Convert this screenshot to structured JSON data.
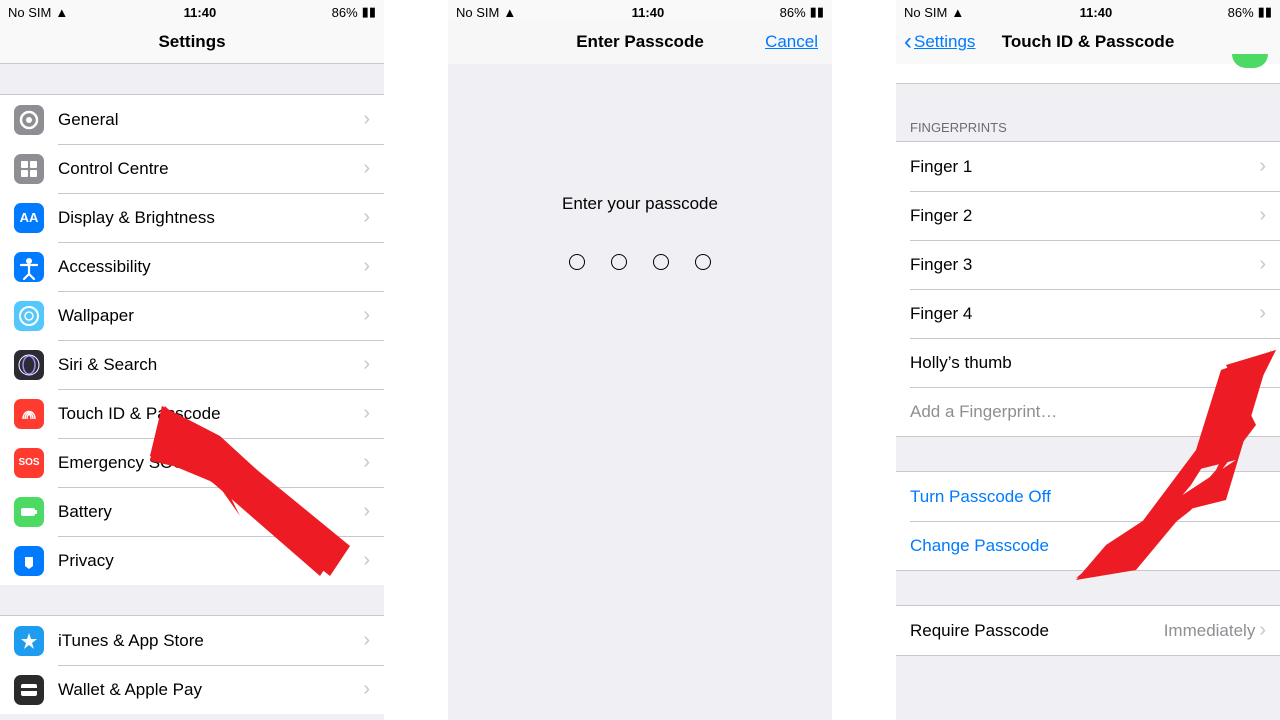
{
  "status": {
    "carrier": "No SIM",
    "time": "11:40",
    "battery": "86%"
  },
  "screen1": {
    "title": "Settings",
    "items1": [
      {
        "label": "General",
        "iconBg": "#8e8e93"
      },
      {
        "label": "Control Centre",
        "iconBg": "#8e8e93"
      },
      {
        "label": "Display & Brightness",
        "iconBg": "#007aff",
        "iconText": "AA"
      },
      {
        "label": "Accessibility",
        "iconBg": "#007aff"
      },
      {
        "label": "Wallpaper",
        "iconBg": "#54c7fc"
      },
      {
        "label": "Siri & Search",
        "iconBg": "#2b2b36"
      },
      {
        "label": "Touch ID & Passcode",
        "iconBg": "#ff3b30"
      },
      {
        "label": "Emergency SOS",
        "iconBg": "#ff3b30",
        "iconText": "SOS"
      },
      {
        "label": "Battery",
        "iconBg": "#4cd964"
      },
      {
        "label": "Privacy",
        "iconBg": "#007aff"
      }
    ],
    "items2": [
      {
        "label": "iTunes & App Store",
        "iconBg": "#1d9cf0"
      },
      {
        "label": "Wallet & Apple Pay",
        "iconBg": "#2b2b2b"
      }
    ]
  },
  "screen2": {
    "title": "Enter Passcode",
    "cancel": "Cancel",
    "prompt": "Enter your passcode"
  },
  "screen3": {
    "back": "Settings",
    "title": "Touch ID & Passcode",
    "fpHeader": "Fingerprints",
    "fingers": [
      "Finger 1",
      "Finger 2",
      "Finger 3",
      "Finger 4",
      "Holly’s thumb"
    ],
    "addFinger": "Add a Fingerprint…",
    "turnOff": "Turn Passcode Off",
    "change": "Change Passcode",
    "require": "Require Passcode",
    "requireVal": "Immediately"
  }
}
